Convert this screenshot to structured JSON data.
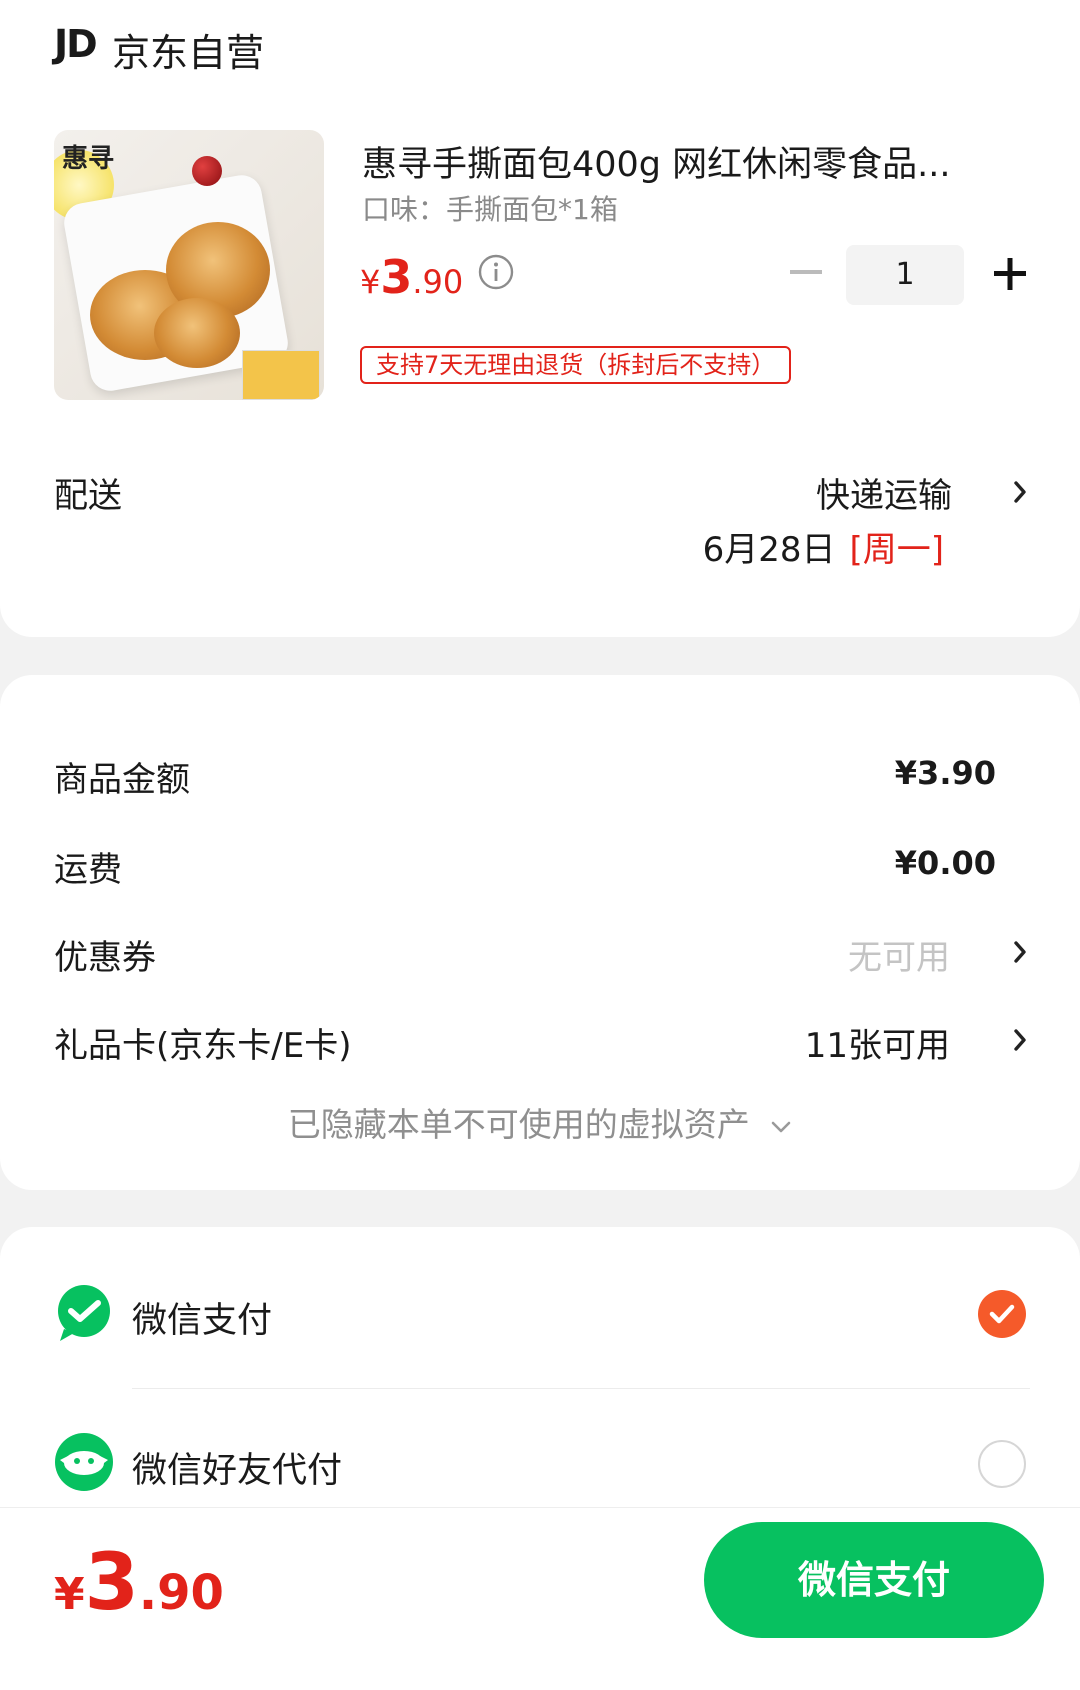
{
  "header": {
    "logo_text": "JD",
    "store_name": "京东自营"
  },
  "product": {
    "title": "惠寻手撕面包400g 网红休闲零食品...",
    "spec": "口味：手撕面包*1箱",
    "price_symbol": "¥",
    "price_int": "3",
    "price_dec": ".90",
    "quantity": "1",
    "return_policy": "支持7天无理由退货（拆封后不支持）",
    "image_brand_text": "惠寻"
  },
  "delivery": {
    "label": "配送",
    "method": "快递运输",
    "date": "6月28日",
    "weekday": "[周一]"
  },
  "summary": {
    "goods_amount_label": "商品金额",
    "goods_amount_value": "¥3.90",
    "shipping_label": "运费",
    "shipping_value": "¥0.00",
    "coupon_label": "优惠券",
    "coupon_value": "无可用",
    "giftcard_label": "礼品卡(京东卡/E卡)",
    "giftcard_value": "11张可用",
    "hidden_assets": "已隐藏本单不可使用的虚拟资产"
  },
  "payment": {
    "options": [
      {
        "label": "微信支付",
        "selected": true
      },
      {
        "label": "微信好友代付",
        "selected": false
      }
    ]
  },
  "footer": {
    "total_symbol": "¥",
    "total_int": "3",
    "total_dec": ".90",
    "pay_button": "微信支付"
  },
  "colors": {
    "accent_red": "#e2231a",
    "wechat_green": "#07c160",
    "check_orange": "#f55a2a"
  },
  "icons": [
    "info-icon",
    "chevron-right-icon",
    "chevron-down-icon",
    "wechat-pay-icon",
    "wechat-friend-pay-icon",
    "check-icon"
  ]
}
